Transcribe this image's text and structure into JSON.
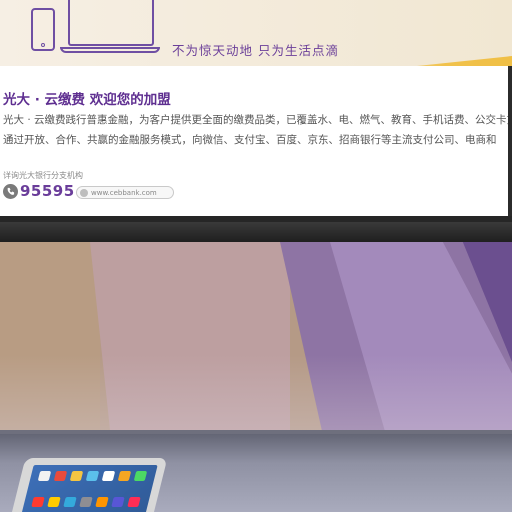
{
  "banner": {
    "slogan": "不为惊天动地 只为生活点滴"
  },
  "panel": {
    "headline": "光大 · 云缴费 欢迎您的加盟",
    "body_lines": [
      "光大 · 云缴费践行普惠金融，为客户提供更全面的缴费品类，已覆盖水、电、燃气、教育、手机话费、公交卡充值",
      "通过开放、合作、共赢的金融服务模式，向微信、支付宝、百度、京东、招商银行等主流支付公司、电商和"
    ],
    "note": "详询光大银行分支机构",
    "hotline": "95595",
    "url": "www.cebbank.com"
  },
  "colors": {
    "brand_purple": "#5e2e90",
    "accent_gold": "#f1c24c"
  },
  "icons": {
    "phone": "phone-icon",
    "laptop": "laptop-icon",
    "telephone": "telephone-icon",
    "globe": "globe-icon"
  }
}
